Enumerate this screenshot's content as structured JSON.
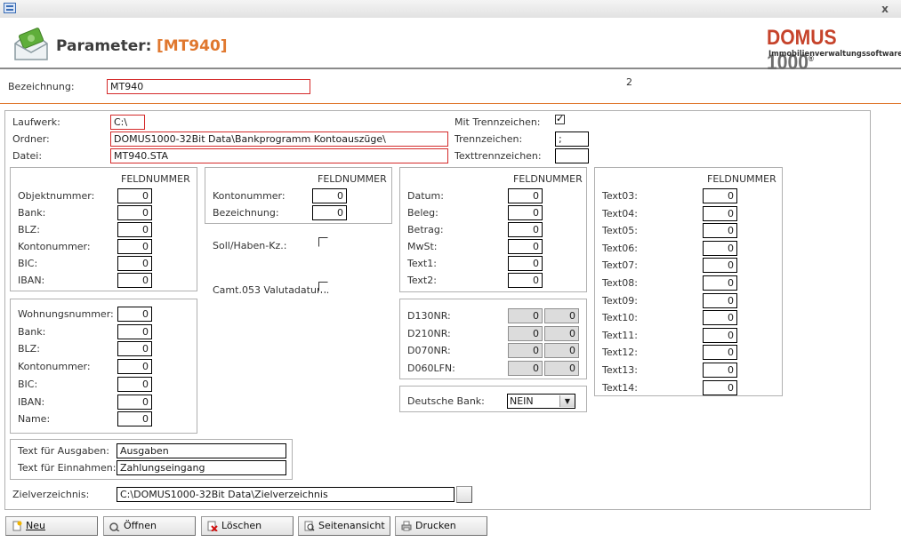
{
  "header": {
    "title": "Parameter:",
    "code": "[MT940]",
    "logo_main_a": "DOMUS ",
    "logo_main_b": "1000",
    "logo_reg": "®",
    "logo_sub": "Immobilienverwaltungssoftware"
  },
  "titlebar": {
    "close": "x"
  },
  "bezeichnung": {
    "label": "Bezeichnung:",
    "value": "MT940"
  },
  "page_number": "2",
  "files": {
    "laufwerk_label": "Laufwerk:",
    "laufwerk_value": "C:\\",
    "ordner_label": "Ordner:",
    "ordner_value": "DOMUS1000-32Bit Data\\Bankprogramm Kontoauszüge\\",
    "datei_label": "Datei:",
    "datei_value": "MT940.STA",
    "mit_trenn_label": "Mit Trennzeichen:",
    "mit_trenn_checked": true,
    "trennzeichen_label": "Trennzeichen:",
    "trennzeichen_value": ";",
    "texttrenn_label": "Texttrennzeichen:",
    "texttrenn_value": ""
  },
  "feldnummer": "FELDNUMMER",
  "group1": {
    "rows": [
      {
        "label": "Objektnummer:",
        "value": "0"
      },
      {
        "label": "Bank:",
        "value": "0"
      },
      {
        "label": "BLZ:",
        "value": "0"
      },
      {
        "label": "Kontonummer:",
        "value": "0"
      },
      {
        "label": "BIC:",
        "value": "0"
      },
      {
        "label": "IBAN:",
        "value": "0"
      }
    ]
  },
  "group2": {
    "rows": [
      {
        "label": "Wohnungsnummer:",
        "value": "0"
      },
      {
        "label": "Bank:",
        "value": "0"
      },
      {
        "label": "BLZ:",
        "value": "0"
      },
      {
        "label": "Kontonummer:",
        "value": "0"
      },
      {
        "label": "BIC:",
        "value": "0"
      },
      {
        "label": "IBAN:",
        "value": "0"
      },
      {
        "label": "Name:",
        "value": "0"
      }
    ]
  },
  "group3": {
    "rows": [
      {
        "label": "Kontonummer:",
        "value": "0"
      },
      {
        "label": "Bezeichnung:",
        "value": "0"
      }
    ]
  },
  "sollhaben": {
    "label": "Soll/Haben-Kz.:"
  },
  "camt": {
    "label": "Camt.053 Valutadatum:"
  },
  "group4": {
    "rows": [
      {
        "label": "Datum:",
        "value": "0"
      },
      {
        "label": "Beleg:",
        "value": "0"
      },
      {
        "label": "Betrag:",
        "value": "0"
      },
      {
        "label": "MwSt:",
        "value": "0"
      },
      {
        "label": "Text1:",
        "value": "0"
      },
      {
        "label": "Text2:",
        "value": "0"
      }
    ]
  },
  "group5": {
    "rows": [
      {
        "label": "D130NR:",
        "a": "0",
        "b": "0"
      },
      {
        "label": "D210NR:",
        "a": "0",
        "b": "0"
      },
      {
        "label": "D070NR:",
        "a": "0",
        "b": "0"
      },
      {
        "label": "D060LFN:",
        "a": "0",
        "b": "0"
      }
    ]
  },
  "deutsche_bank": {
    "label": "Deutsche Bank:",
    "value": "NEIN"
  },
  "group6": {
    "rows": [
      {
        "label": "Text03:",
        "value": "0"
      },
      {
        "label": "Text04:",
        "value": "0"
      },
      {
        "label": "Text05:",
        "value": "0"
      },
      {
        "label": "Text06:",
        "value": "0"
      },
      {
        "label": "Text07:",
        "value": "0"
      },
      {
        "label": "Text08:",
        "value": "0"
      },
      {
        "label": "Text09:",
        "value": "0"
      },
      {
        "label": "Text10:",
        "value": "0"
      },
      {
        "label": "Text11:",
        "value": "0"
      },
      {
        "label": "Text12:",
        "value": "0"
      },
      {
        "label": "Text13:",
        "value": "0"
      },
      {
        "label": "Text14:",
        "value": "0"
      }
    ]
  },
  "texts": {
    "ausgaben_label": "Text für Ausgaben:",
    "ausgaben_value": "Ausgaben",
    "einnahmen_label": "Text für Einnahmen:",
    "einnahmen_value": "Zahlungseingang"
  },
  "zielverzeichnis": {
    "label": "Zielverzeichnis:",
    "value": "C:\\DOMUS1000-32Bit Data\\Zielverzeichnis"
  },
  "buttons": {
    "neu": "Neu",
    "oeffnen": "Öffnen",
    "loeschen": "Löschen",
    "seitenansicht": "Seitenansicht",
    "drucken": "Drucken"
  },
  "colors": {
    "accent": "#e0782f",
    "logo_red": "#c6432b",
    "required_border": "#d42a2a"
  }
}
